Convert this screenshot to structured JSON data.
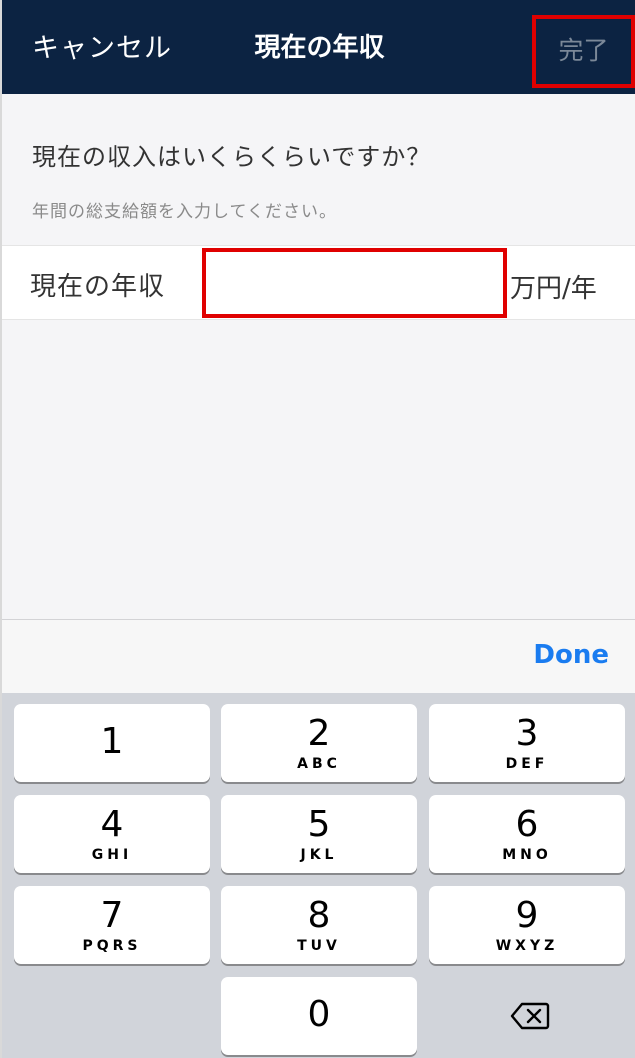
{
  "header": {
    "cancel_label": "キャンセル",
    "title": "現在の年収",
    "done_label": "完了"
  },
  "question": {
    "text": "現在の収入はいくらくらいですか？",
    "hint": "年間の総支給額を入力してください。"
  },
  "income_row": {
    "label": "現在の年収",
    "value": "",
    "unit": "万円/年"
  },
  "keyboard": {
    "done_label": "Done",
    "keys": [
      {
        "num": "1",
        "letters": ""
      },
      {
        "num": "2",
        "letters": "ABC"
      },
      {
        "num": "3",
        "letters": "DEF"
      },
      {
        "num": "4",
        "letters": "GHI"
      },
      {
        "num": "5",
        "letters": "JKL"
      },
      {
        "num": "6",
        "letters": "MNO"
      },
      {
        "num": "7",
        "letters": "PQRS"
      },
      {
        "num": "8",
        "letters": "TUV"
      },
      {
        "num": "9",
        "letters": "WXYZ"
      },
      {
        "num": "0",
        "letters": ""
      }
    ],
    "backspace_icon": "backspace-icon"
  },
  "colors": {
    "header_bg": "#0c2342",
    "highlight_box": "#e00000",
    "done_blue": "#1a7cf0"
  }
}
